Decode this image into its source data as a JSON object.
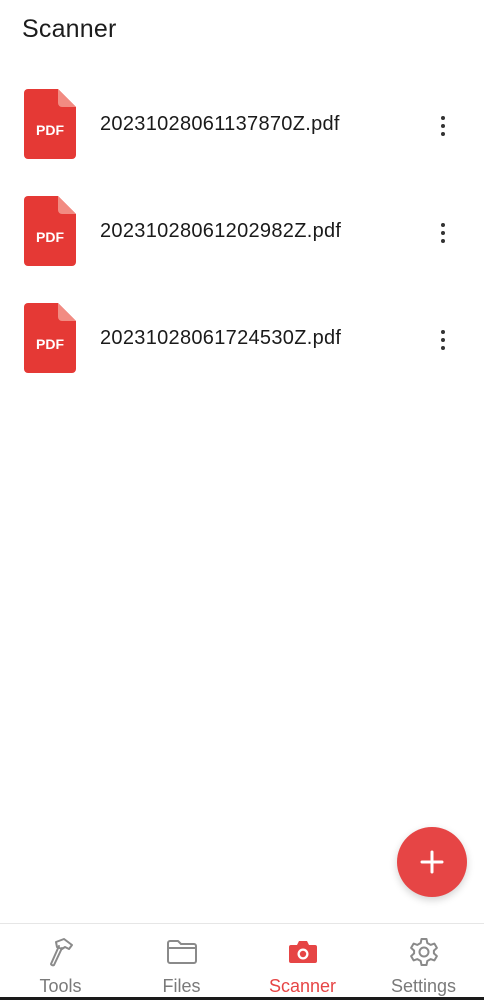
{
  "app_bar": {
    "title": "Scanner"
  },
  "files": [
    {
      "name": "20231028061137870Z.pdf",
      "icon_label": "PDF"
    },
    {
      "name": "20231028061202982Z.pdf",
      "icon_label": "PDF"
    },
    {
      "name": "20231028061724530Z.pdf",
      "icon_label": "PDF"
    }
  ],
  "bottom_nav": {
    "items": [
      {
        "label": "Tools",
        "icon": "hammer-icon",
        "active": false
      },
      {
        "label": "Files",
        "icon": "folder-icon",
        "active": false
      },
      {
        "label": "Scanner",
        "icon": "camera-icon",
        "active": true
      },
      {
        "label": "Settings",
        "icon": "gear-icon",
        "active": false
      }
    ]
  },
  "colors": {
    "accent": "#e64545",
    "pdf_red": "#e53935",
    "pdf_fold": "#f28b82",
    "inactive": "#7a7a7a"
  }
}
